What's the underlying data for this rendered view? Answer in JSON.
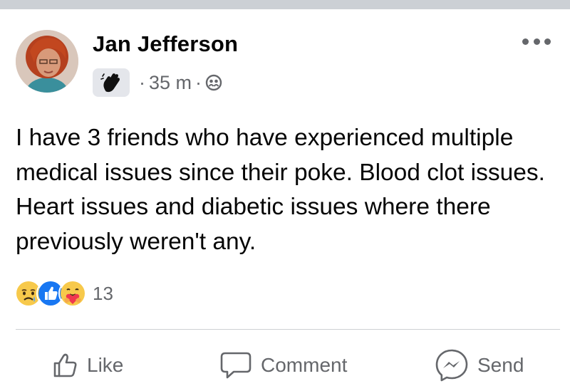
{
  "post": {
    "author_name": "Jan Jefferson",
    "badge_icon": "waving-hand-icon",
    "separator": "·",
    "time": "35 m",
    "audience_icon": "friends-icon",
    "more_icon": "more-options-icon",
    "text": "I have 3 friends who have experienced multiple medical issues since their poke. Blood clot issues. Heart issues and diabetic issues where there previously weren't any.",
    "reactions": {
      "icons": [
        "sad-reaction-icon",
        "like-reaction-icon",
        "care-reaction-icon"
      ],
      "count": "13"
    }
  },
  "actions": {
    "like_label": "Like",
    "comment_label": "Comment",
    "send_label": "Send"
  },
  "colors": {
    "secondary_text": "#65676b",
    "like_blue": "#1877f2",
    "divider": "#ced0d4"
  }
}
